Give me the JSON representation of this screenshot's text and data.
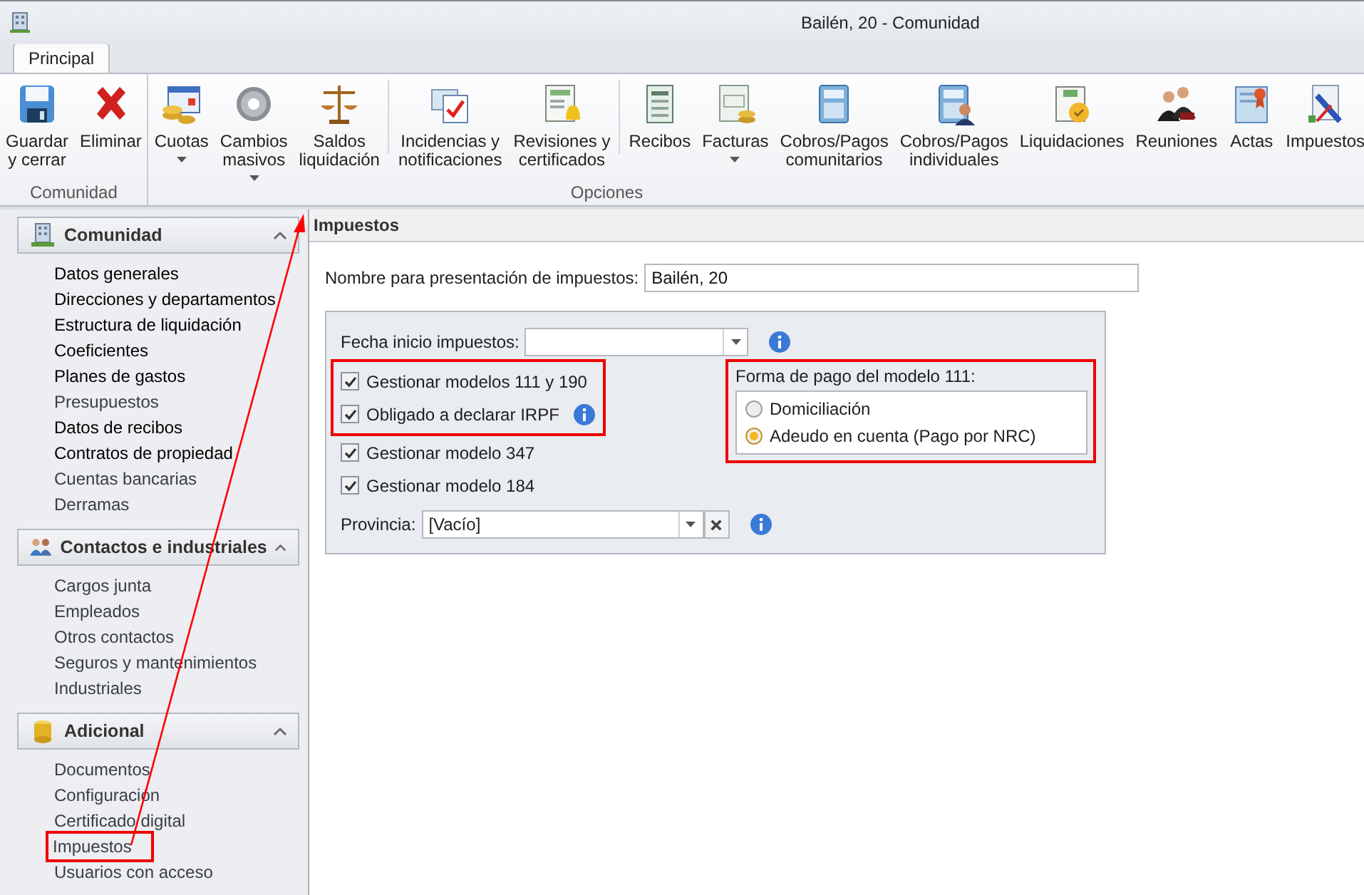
{
  "window": {
    "title": "Bailén, 20 - Comunidad"
  },
  "tabs": [
    {
      "label": "Principal",
      "selected": true
    }
  ],
  "ribbon": {
    "groups": [
      {
        "label": "Comunidad",
        "sections": [
          [
            {
              "lines": [
                "Guardar",
                "y cerrar"
              ],
              "dropdown": false
            },
            {
              "lines": [
                "Eliminar"
              ],
              "dropdown": false
            }
          ]
        ]
      },
      {
        "label": "Opciones",
        "sections": [
          [
            {
              "lines": [
                "Cuotas"
              ],
              "dropdown": true
            },
            {
              "lines": [
                "Cambios",
                "masivos"
              ],
              "dropdown": true
            },
            {
              "lines": [
                "Saldos",
                "liquidación"
              ],
              "dropdown": false
            }
          ],
          [
            {
              "lines": [
                "Incidencias y",
                "notificaciones"
              ],
              "dropdown": false
            },
            {
              "lines": [
                "Revisiones y",
                "certificados"
              ],
              "dropdown": false
            }
          ],
          [
            {
              "lines": [
                "Recibos"
              ],
              "dropdown": false
            },
            {
              "lines": [
                "Facturas"
              ],
              "dropdown": true
            },
            {
              "lines": [
                "Cobros/Pagos",
                "comunitarios"
              ],
              "dropdown": false
            },
            {
              "lines": [
                "Cobros/Pagos",
                "individuales"
              ],
              "dropdown": false
            },
            {
              "lines": [
                "Liquidaciones"
              ],
              "dropdown": false
            },
            {
              "lines": [
                "Reuniones"
              ],
              "dropdown": false
            },
            {
              "lines": [
                "Actas"
              ],
              "dropdown": false
            },
            {
              "lines": [
                "Impuestos"
              ],
              "dropdown": false
            }
          ]
        ]
      }
    ]
  },
  "sidebar": {
    "sections": [
      {
        "title": "Comunidad",
        "expanded": true,
        "items": [
          {
            "label": "Datos generales",
            "emphasized": true,
            "highlighted": false
          },
          {
            "label": "Direcciones y departamentos",
            "emphasized": true,
            "highlighted": false
          },
          {
            "label": "Estructura de liquidación",
            "emphasized": true,
            "highlighted": false
          },
          {
            "label": "Coeficientes",
            "emphasized": true,
            "highlighted": false
          },
          {
            "label": "Planes de gastos",
            "emphasized": true,
            "highlighted": false
          },
          {
            "label": "Presupuestos",
            "emphasized": false,
            "highlighted": false
          },
          {
            "label": "Datos de recibos",
            "emphasized": true,
            "highlighted": false
          },
          {
            "label": "Contratos de propiedad",
            "emphasized": true,
            "highlighted": false
          },
          {
            "label": "Cuentas bancarias",
            "emphasized": false,
            "highlighted": false
          },
          {
            "label": "Derramas",
            "emphasized": false,
            "highlighted": false
          }
        ]
      },
      {
        "title": "Contactos e industriales",
        "expanded": true,
        "items": [
          {
            "label": "Cargos junta",
            "emphasized": false,
            "highlighted": false
          },
          {
            "label": "Empleados",
            "emphasized": false,
            "highlighted": false
          },
          {
            "label": "Otros contactos",
            "emphasized": false,
            "highlighted": false
          },
          {
            "label": "Seguros y mantenimientos",
            "emphasized": false,
            "highlighted": false
          },
          {
            "label": "Industriales",
            "emphasized": false,
            "highlighted": false
          }
        ]
      },
      {
        "title": "Adicional",
        "expanded": true,
        "items": [
          {
            "label": "Documentos",
            "emphasized": false,
            "highlighted": false
          },
          {
            "label": "Configuración",
            "emphasized": false,
            "highlighted": false
          },
          {
            "label": "Certificado digital",
            "emphasized": false,
            "highlighted": false
          },
          {
            "label": "Impuestos",
            "emphasized": false,
            "highlighted": true
          },
          {
            "label": "Usuarios con acceso",
            "emphasized": false,
            "highlighted": false
          }
        ]
      }
    ]
  },
  "annotation_arrow": true,
  "panel": {
    "title": "Impuestos"
  },
  "name_field": {
    "label": "Nombre para presentación de impuestos:",
    "value": "Bailén, 20"
  },
  "date_field": {
    "label": "Fecha inicio impuestos:",
    "info": true
  },
  "checkbox_groups": [
    {
      "highlighted": true,
      "items": [
        {
          "label": "Gestionar modelos 111 y 190",
          "checked": true,
          "info": false
        },
        {
          "label": "Obligado a declarar IRPF",
          "checked": true,
          "info": true
        }
      ]
    },
    {
      "highlighted": false,
      "items": [
        {
          "label": "Gestionar modelo 347",
          "checked": true,
          "info": false
        },
        {
          "label": "Gestionar modelo 184",
          "checked": true,
          "info": false
        }
      ]
    }
  ],
  "payment": {
    "title": "Forma de pago del modelo 111:",
    "highlighted": true,
    "options": [
      {
        "label": "Domiciliación",
        "selected": false
      },
      {
        "label": "Adeudo en cuenta (Pago por NRC)",
        "selected": true
      }
    ]
  },
  "province_field": {
    "label": "Provincia:",
    "value": "[Vacío]",
    "clearable": true,
    "info": true
  }
}
